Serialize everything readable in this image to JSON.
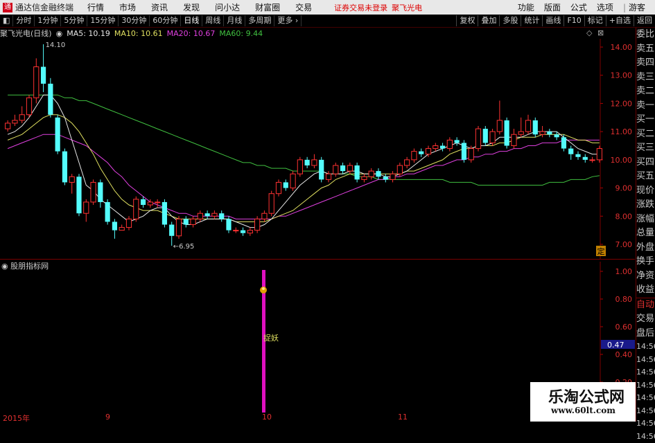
{
  "titlebar": {
    "app_title": "通达信金融终端",
    "menus": [
      "行情",
      "市场",
      "资讯",
      "发现",
      "问小达",
      "财富圈",
      "交易"
    ],
    "warning": "证券交易未登录",
    "stock_name": "聚飞光电",
    "right_menus": [
      "功能",
      "版面",
      "公式",
      "选项"
    ],
    "guest": "游客"
  },
  "toolbar": {
    "periods": [
      "分时",
      "1分钟",
      "5分钟",
      "15分钟",
      "30分钟",
      "60分钟",
      "日线",
      "周线",
      "月线",
      "多周期",
      "更多"
    ],
    "active_period": "日线",
    "right_buttons": [
      "复权",
      "叠加",
      "多股",
      "统计",
      "画线",
      "F10",
      "标记",
      "+自选",
      "返回"
    ]
  },
  "chart_header": {
    "title": "聚飞光电(日线)",
    "ma5": "MA5: 10.19",
    "ma10": "MA10: 10.61",
    "ma20": "MA20: 10.67",
    "ma60": "MA60: 9.44",
    "ma_colors": {
      "ma5": "#e8e8e8",
      "ma10": "#e0e060",
      "ma20": "#e040e0",
      "ma60": "#40c040"
    }
  },
  "indicator_header": {
    "title": "股朋指标网"
  },
  "right_panel": {
    "items": [
      "委比",
      "卖五",
      "卖四",
      "卖三",
      "卖二",
      "卖一",
      "买一",
      "买二",
      "买三",
      "买四",
      "买五",
      "现价",
      "涨跌",
      "涨幅",
      "总量",
      "外盘",
      "换手",
      "净资",
      "收益"
    ],
    "lower_items": [
      "自动",
      "交易",
      "盘后"
    ],
    "times": [
      "14:56",
      "14:56",
      "14:56",
      "14:56",
      "14:56",
      "14:56",
      "14:56",
      "14:56"
    ]
  },
  "chart_data": {
    "type": "candlestick",
    "y_axis_ticks": [
      "14.00",
      "13.00",
      "12.00",
      "11.00",
      "10.00",
      "9.00",
      "8.00",
      "7.00"
    ],
    "ylim": [
      6.7,
      14.4
    ],
    "high_label": "14.10",
    "low_label": "6.95",
    "indicator_ticks": [
      "1.00",
      "0.80",
      "0.60",
      "0.40",
      "0.20",
      "0.00"
    ],
    "indicator_value": "0.47",
    "signal_label": "捉妖",
    "x_labels": [
      "2015年",
      "9",
      "10",
      "11"
    ],
    "fixed_badge": "定",
    "candles": [
      [
        11.1,
        11.3,
        11.0,
        11.4
      ],
      [
        11.3,
        11.4,
        11.2,
        11.6
      ],
      [
        11.4,
        11.6,
        11.3,
        11.9
      ],
      [
        11.6,
        12.2,
        11.5,
        12.3
      ],
      [
        12.2,
        13.3,
        12.0,
        13.6
      ],
      [
        13.3,
        12.7,
        12.4,
        14.1
      ],
      [
        12.7,
        11.6,
        11.5,
        12.9
      ],
      [
        11.5,
        10.3,
        10.2,
        11.6
      ],
      [
        10.3,
        9.2,
        9.1,
        10.4
      ],
      [
        9.2,
        9.4,
        8.8,
        9.5
      ],
      [
        9.4,
        8.1,
        8.0,
        9.5
      ],
      [
        8.1,
        8.5,
        7.8,
        8.6
      ],
      [
        8.5,
        9.2,
        8.4,
        9.3
      ],
      [
        9.2,
        8.5,
        8.3,
        9.3
      ],
      [
        8.5,
        7.8,
        7.7,
        8.6
      ],
      [
        7.8,
        7.5,
        7.2,
        7.9
      ],
      [
        7.5,
        7.6,
        7.5,
        7.7
      ],
      [
        7.6,
        7.9,
        7.5,
        8.0
      ],
      [
        7.9,
        8.6,
        7.8,
        8.7
      ],
      [
        8.6,
        8.4,
        8.3,
        8.7
      ],
      [
        8.4,
        8.5,
        8.3,
        8.6
      ],
      [
        8.5,
        8.5,
        8.3,
        8.6
      ],
      [
        8.5,
        7.7,
        7.6,
        8.6
      ],
      [
        7.7,
        7.3,
        6.95,
        7.8
      ],
      [
        7.3,
        7.9,
        7.2,
        8.0
      ],
      [
        7.9,
        7.7,
        7.6,
        8.0
      ],
      [
        7.7,
        7.9,
        7.6,
        8.0
      ],
      [
        7.9,
        8.1,
        7.8,
        8.2
      ],
      [
        8.1,
        8.0,
        7.9,
        8.2
      ],
      [
        8.0,
        8.1,
        7.9,
        8.2
      ],
      [
        8.1,
        7.9,
        7.8,
        8.2
      ],
      [
        7.9,
        7.5,
        7.4,
        8.0
      ],
      [
        7.5,
        7.5,
        7.4,
        7.6
      ],
      [
        7.5,
        7.4,
        7.3,
        7.6
      ],
      [
        7.4,
        7.5,
        7.3,
        7.6
      ],
      [
        7.5,
        7.9,
        7.4,
        8.0
      ],
      [
        7.9,
        8.1,
        7.8,
        8.2
      ],
      [
        8.1,
        8.8,
        8.0,
        8.9
      ],
      [
        8.8,
        9.2,
        8.7,
        9.3
      ],
      [
        9.2,
        9.0,
        8.9,
        9.3
      ],
      [
        9.0,
        9.5,
        8.9,
        9.6
      ],
      [
        9.5,
        10.0,
        9.4,
        10.1
      ],
      [
        10.0,
        9.8,
        9.7,
        10.1
      ],
      [
        9.8,
        10.0,
        9.7,
        10.2
      ],
      [
        10.0,
        9.3,
        9.2,
        10.1
      ],
      [
        9.3,
        9.5,
        9.2,
        9.6
      ],
      [
        9.5,
        9.8,
        9.4,
        9.9
      ],
      [
        9.8,
        9.6,
        9.5,
        9.9
      ],
      [
        9.6,
        9.8,
        9.5,
        9.9
      ],
      [
        9.8,
        9.3,
        9.2,
        9.9
      ],
      [
        9.3,
        9.4,
        9.2,
        9.5
      ],
      [
        9.4,
        9.6,
        9.3,
        9.7
      ],
      [
        9.6,
        9.4,
        9.3,
        9.7
      ],
      [
        9.4,
        9.3,
        9.2,
        9.5
      ],
      [
        9.3,
        9.5,
        9.2,
        9.6
      ],
      [
        9.5,
        9.8,
        9.4,
        9.9
      ],
      [
        9.8,
        10.0,
        9.7,
        10.1
      ],
      [
        10.0,
        10.3,
        9.9,
        10.4
      ],
      [
        10.3,
        10.2,
        10.1,
        10.4
      ],
      [
        10.2,
        10.4,
        10.1,
        10.5
      ],
      [
        10.4,
        10.5,
        10.3,
        10.6
      ],
      [
        10.5,
        10.4,
        10.3,
        10.6
      ],
      [
        10.4,
        10.7,
        10.3,
        10.8
      ],
      [
        10.7,
        10.6,
        10.5,
        10.8
      ],
      [
        10.6,
        10.0,
        9.9,
        10.7
      ],
      [
        10.0,
        10.4,
        9.9,
        10.5
      ],
      [
        10.4,
        11.1,
        10.3,
        11.2
      ],
      [
        11.1,
        10.6,
        10.5,
        11.2
      ],
      [
        10.6,
        11.0,
        10.5,
        11.1
      ],
      [
        11.0,
        11.4,
        10.9,
        12.1
      ],
      [
        11.4,
        10.5,
        10.4,
        11.5
      ],
      [
        10.5,
        10.9,
        10.4,
        11.1
      ],
      [
        10.9,
        11.0,
        10.8,
        11.5
      ],
      [
        11.0,
        11.4,
        10.9,
        11.6
      ],
      [
        11.4,
        10.9,
        10.8,
        11.5
      ],
      [
        10.9,
        11.0,
        10.8,
        11.2
      ],
      [
        11.0,
        10.9,
        10.8,
        11.1
      ],
      [
        10.9,
        10.8,
        10.7,
        11.0
      ],
      [
        10.8,
        10.4,
        10.3,
        10.9
      ],
      [
        10.4,
        10.2,
        10.0,
        10.5
      ],
      [
        10.2,
        10.1,
        10.0,
        10.3
      ],
      [
        10.1,
        10.0,
        9.9,
        10.2
      ],
      [
        10.0,
        10.0,
        9.9,
        10.1
      ],
      [
        10.0,
        10.4,
        9.9,
        10.5
      ]
    ],
    "ma5": [
      10.9,
      11.0,
      11.2,
      11.5,
      11.9,
      12.3,
      12.3,
      12.0,
      11.5,
      10.7,
      9.9,
      9.1,
      8.9,
      8.6,
      8.4,
      8.2,
      8.0,
      7.8,
      7.9,
      8.0,
      8.2,
      8.3,
      8.3,
      8.0,
      7.8,
      7.7,
      7.7,
      7.8,
      7.9,
      7.9,
      7.9,
      7.9,
      7.8,
      7.7,
      7.6,
      7.6,
      7.7,
      7.9,
      8.2,
      8.5,
      8.8,
      9.1,
      9.3,
      9.5,
      9.6,
      9.5,
      9.5,
      9.5,
      9.6,
      9.6,
      9.5,
      9.5,
      9.5,
      9.4,
      9.4,
      9.5,
      9.6,
      9.8,
      10.0,
      10.2,
      10.3,
      10.4,
      10.5,
      10.6,
      10.5,
      10.4,
      10.5,
      10.5,
      10.6,
      10.8,
      10.8,
      10.8,
      10.8,
      10.9,
      11.0,
      11.0,
      11.0,
      11.0,
      10.8,
      10.6,
      10.4,
      10.3,
      10.2,
      10.2
    ],
    "ma10": [
      10.7,
      10.8,
      10.9,
      11.1,
      11.3,
      11.5,
      11.6,
      11.6,
      11.5,
      11.3,
      11.0,
      10.6,
      10.2,
      9.7,
      9.3,
      8.9,
      8.6,
      8.4,
      8.3,
      8.2,
      8.2,
      8.2,
      8.1,
      8.0,
      7.9,
      7.9,
      7.9,
      7.9,
      7.9,
      7.9,
      7.9,
      7.9,
      7.8,
      7.8,
      7.8,
      7.8,
      7.8,
      7.9,
      8.0,
      8.1,
      8.2,
      8.4,
      8.6,
      8.8,
      9.0,
      9.1,
      9.3,
      9.4,
      9.5,
      9.5,
      9.5,
      9.5,
      9.5,
      9.5,
      9.5,
      9.5,
      9.6,
      9.6,
      9.7,
      9.8,
      9.9,
      10.0,
      10.2,
      10.3,
      10.4,
      10.4,
      10.5,
      10.5,
      10.5,
      10.6,
      10.6,
      10.7,
      10.8,
      10.8,
      10.8,
      10.9,
      10.9,
      10.9,
      10.9,
      10.8,
      10.7,
      10.7,
      10.6,
      10.6
    ],
    "ma20": [
      10.4,
      10.5,
      10.6,
      10.7,
      10.8,
      10.9,
      10.9,
      10.9,
      10.8,
      10.7,
      10.6,
      10.5,
      10.3,
      10.1,
      9.9,
      9.6,
      9.4,
      9.1,
      8.9,
      8.7,
      8.5,
      8.4,
      8.3,
      8.2,
      8.1,
      8.1,
      8.0,
      8.0,
      8.0,
      8.0,
      8.0,
      8.0,
      7.9,
      7.9,
      7.9,
      7.9,
      7.9,
      7.9,
      8.0,
      8.0,
      8.1,
      8.2,
      8.3,
      8.4,
      8.5,
      8.6,
      8.7,
      8.8,
      8.9,
      9.0,
      9.1,
      9.2,
      9.3,
      9.3,
      9.4,
      9.4,
      9.5,
      9.5,
      9.6,
      9.7,
      9.8,
      9.8,
      9.9,
      10.0,
      10.0,
      10.1,
      10.1,
      10.2,
      10.2,
      10.3,
      10.3,
      10.4,
      10.4,
      10.5,
      10.5,
      10.6,
      10.6,
      10.6,
      10.7,
      10.7,
      10.7,
      10.7,
      10.7,
      10.7
    ],
    "ma60": [
      12.3,
      12.3,
      12.3,
      12.3,
      12.3,
      12.3,
      12.3,
      12.3,
      12.2,
      12.2,
      12.1,
      12.1,
      12.0,
      11.9,
      11.8,
      11.7,
      11.6,
      11.5,
      11.4,
      11.3,
      11.2,
      11.1,
      11.0,
      10.9,
      10.8,
      10.7,
      10.6,
      10.5,
      10.4,
      10.3,
      10.2,
      10.1,
      10.0,
      9.9,
      9.9,
      9.8,
      9.8,
      9.7,
      9.7,
      9.7,
      9.6,
      9.6,
      9.6,
      9.6,
      9.6,
      9.5,
      9.5,
      9.5,
      9.5,
      9.4,
      9.4,
      9.4,
      9.3,
      9.3,
      9.3,
      9.3,
      9.3,
      9.3,
      9.3,
      9.3,
      9.3,
      9.3,
      9.2,
      9.2,
      9.2,
      9.2,
      9.1,
      9.1,
      9.1,
      9.1,
      9.1,
      9.1,
      9.1,
      9.1,
      9.1,
      9.1,
      9.2,
      9.2,
      9.2,
      9.3,
      9.3,
      9.3,
      9.4,
      9.44
    ]
  }
}
